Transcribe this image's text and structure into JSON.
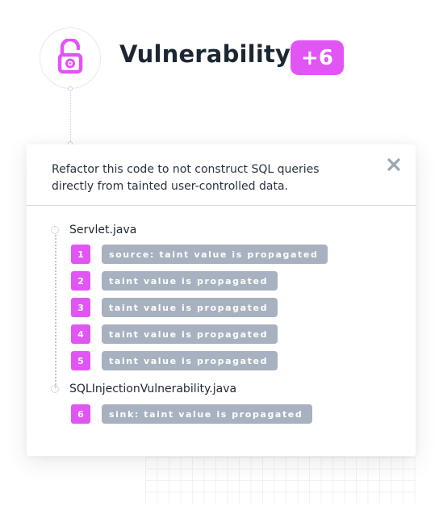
{
  "header": {
    "title": "Vulnerability",
    "badge": "+6",
    "icon": "unlocked-padlock-icon"
  },
  "colors": {
    "accent": "#e155f5",
    "title_text": "#1d2733",
    "step_label_bg": "#a7b1bf",
    "divider": "#d3dbe6"
  },
  "card": {
    "message": "Refactor this code to not construct SQL queries directly from tainted user-controlled data.",
    "close_icon": "close-icon",
    "files": [
      {
        "name": "Servlet.java",
        "steps": [
          {
            "number": "1",
            "label": "source: taint value is propagated"
          },
          {
            "number": "2",
            "label": "taint value is propagated"
          },
          {
            "number": "3",
            "label": "taint value is propagated"
          },
          {
            "number": "4",
            "label": "taint value is propagated"
          },
          {
            "number": "5",
            "label": "taint value is propagated"
          }
        ]
      },
      {
        "name": "SQLInjectionVulnerability.java",
        "steps": [
          {
            "number": "6",
            "label": "sink: taint value is propagated"
          }
        ]
      }
    ]
  }
}
